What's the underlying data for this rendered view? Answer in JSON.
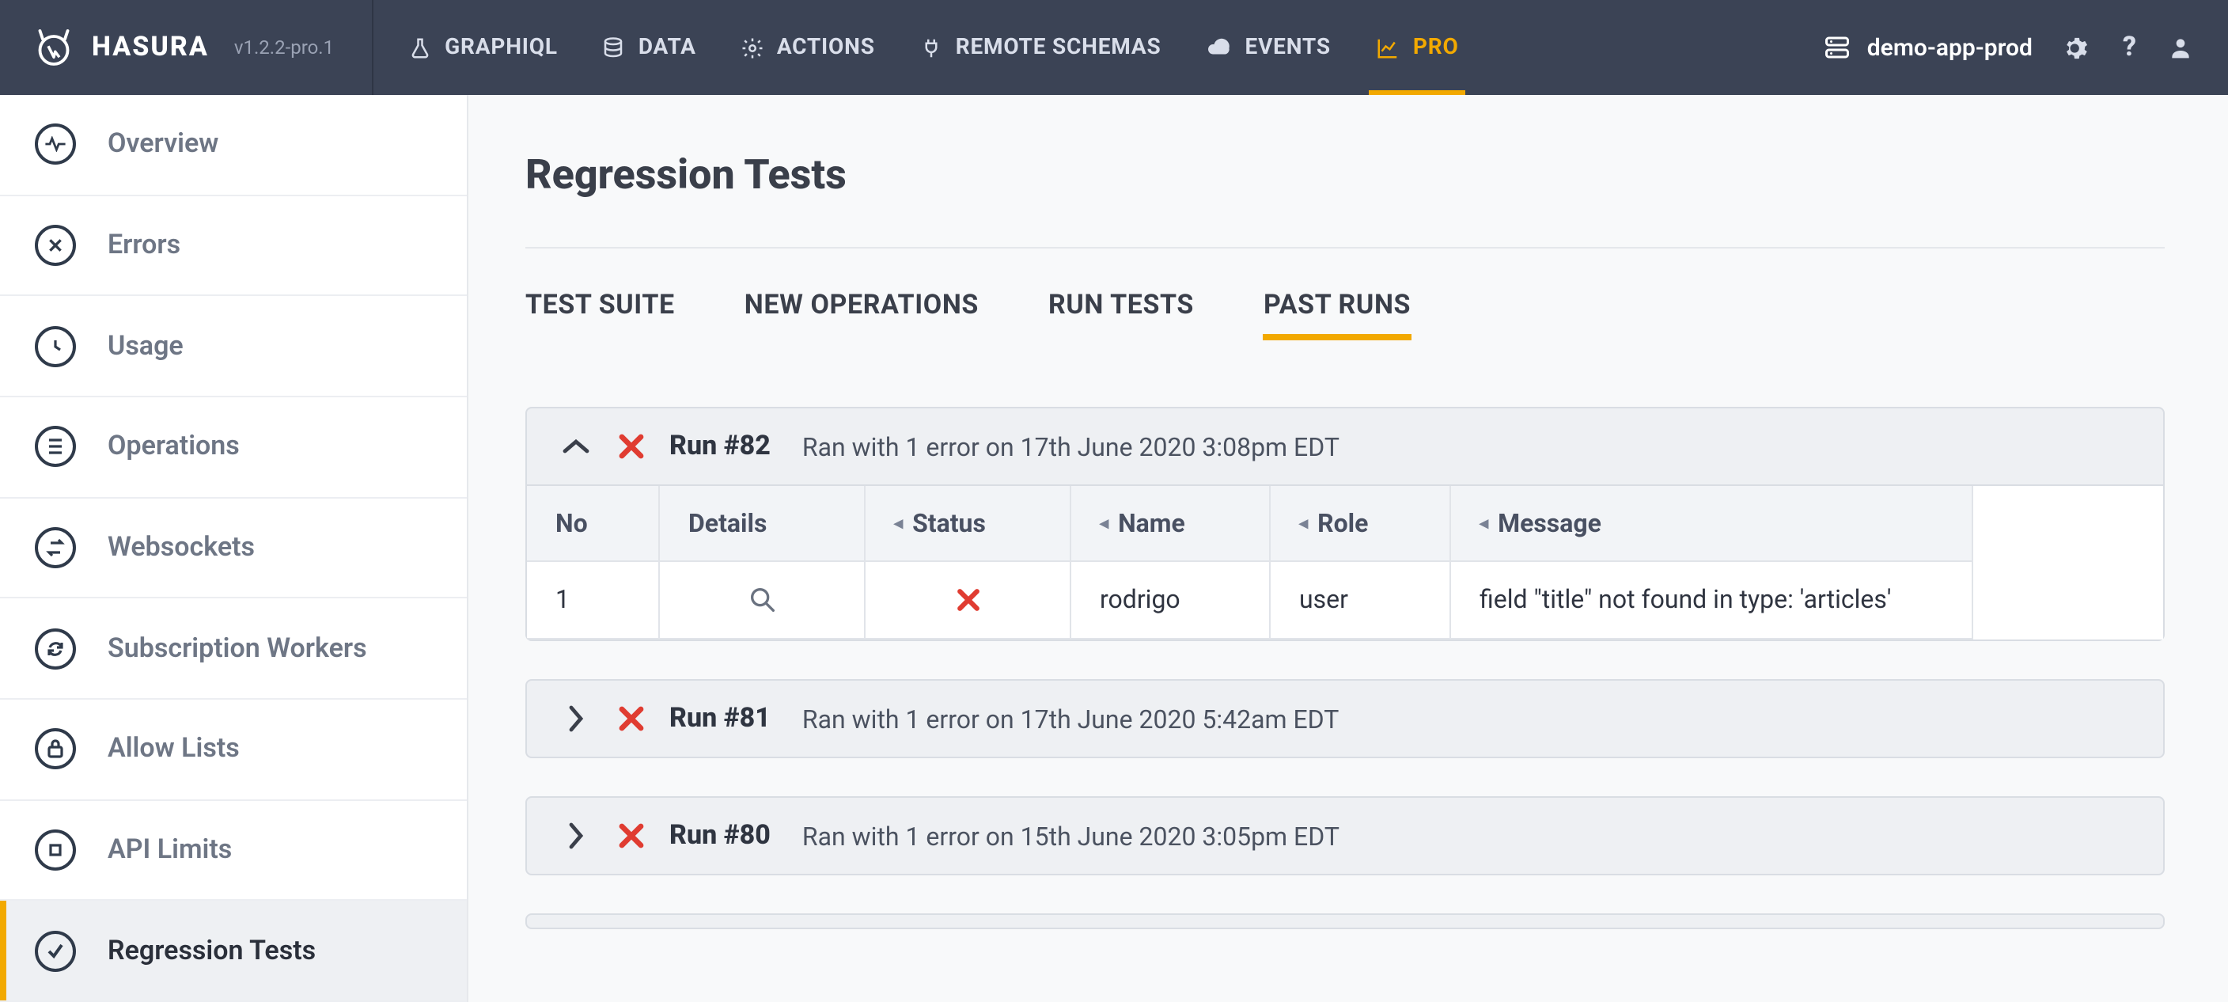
{
  "brand": {
    "name": "HASURA",
    "version": "v1.2.2-pro.1"
  },
  "nav": {
    "items": [
      {
        "label": "GRAPHIQL",
        "icon": "flask-icon"
      },
      {
        "label": "DATA",
        "icon": "database-icon"
      },
      {
        "label": "ACTIONS",
        "icon": "gears-icon"
      },
      {
        "label": "REMOTE SCHEMAS",
        "icon": "plug-icon"
      },
      {
        "label": "EVENTS",
        "icon": "cloud-icon"
      },
      {
        "label": "PRO",
        "icon": "chart-line-icon",
        "active": true
      }
    ],
    "project": "demo-app-prod"
  },
  "sidebar": {
    "items": [
      {
        "label": "Overview",
        "icon": "pulse-icon"
      },
      {
        "label": "Errors",
        "icon": "x-circle-icon"
      },
      {
        "label": "Usage",
        "icon": "clock-icon"
      },
      {
        "label": "Operations",
        "icon": "list-icon"
      },
      {
        "label": "Websockets",
        "icon": "swap-icon"
      },
      {
        "label": "Subscription Workers",
        "icon": "refresh-icon"
      },
      {
        "label": "Allow Lists",
        "icon": "lock-icon"
      },
      {
        "label": "API Limits",
        "icon": "stop-icon"
      },
      {
        "label": "Regression Tests",
        "icon": "check-circle-icon",
        "active": true
      }
    ]
  },
  "page": {
    "title": "Regression Tests",
    "tabs": [
      {
        "label": "TEST SUITE"
      },
      {
        "label": "NEW OPERATIONS"
      },
      {
        "label": "RUN TESTS"
      },
      {
        "label": "PAST RUNS",
        "active": true
      }
    ]
  },
  "runs": [
    {
      "title": "Run #82",
      "subtitle": "Ran with 1 error on 17th June 2020 3:08pm EDT",
      "expanded": true,
      "status": "fail",
      "columns": [
        "No",
        "Details",
        "Status",
        "Name",
        "Role",
        "Message"
      ],
      "rows": [
        {
          "no": "1",
          "name": "rodrigo",
          "role": "user",
          "message": "field \"title\" not found in type: 'articles'",
          "status": "fail"
        }
      ]
    },
    {
      "title": "Run #81",
      "subtitle": "Ran with 1 error on 17th June 2020 5:42am EDT",
      "expanded": false,
      "status": "fail"
    },
    {
      "title": "Run #80",
      "subtitle": "Ran with 1 error on 15th June 2020 3:05pm EDT",
      "expanded": false,
      "status": "fail"
    }
  ]
}
